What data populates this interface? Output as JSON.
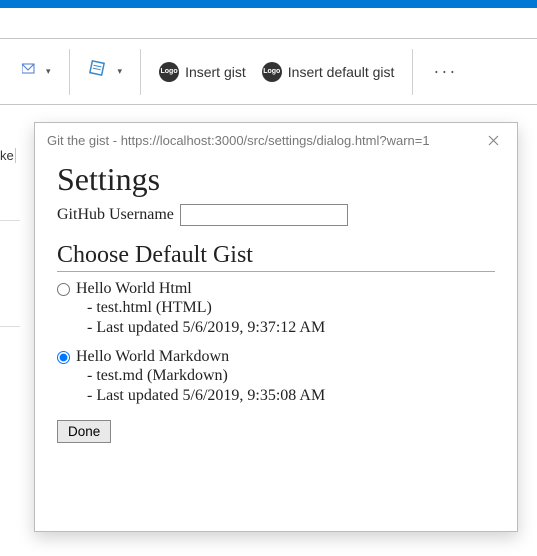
{
  "ribbon": {
    "insert_gist_label": "Insert gist",
    "insert_default_gist_label": "Insert default gist",
    "logo_text": "Logo",
    "ellipsis": "···"
  },
  "partial_text": "ke",
  "dialog": {
    "title": "Git the gist - https://localhost:3000/src/settings/dialog.html?warn=1",
    "settings_heading": "Settings",
    "username_label": "GitHub Username",
    "username_value": "",
    "choose_heading": "Choose Default Gist",
    "gists": [
      {
        "name": "Hello World Html",
        "file_line": "- test.html (HTML)",
        "updated_line": "- Last updated 5/6/2019, 9:37:12 AM",
        "selected": false
      },
      {
        "name": "Hello World Markdown",
        "file_line": "- test.md (Markdown)",
        "updated_line": "- Last updated 5/6/2019, 9:35:08 AM",
        "selected": true
      }
    ],
    "done_label": "Done"
  }
}
